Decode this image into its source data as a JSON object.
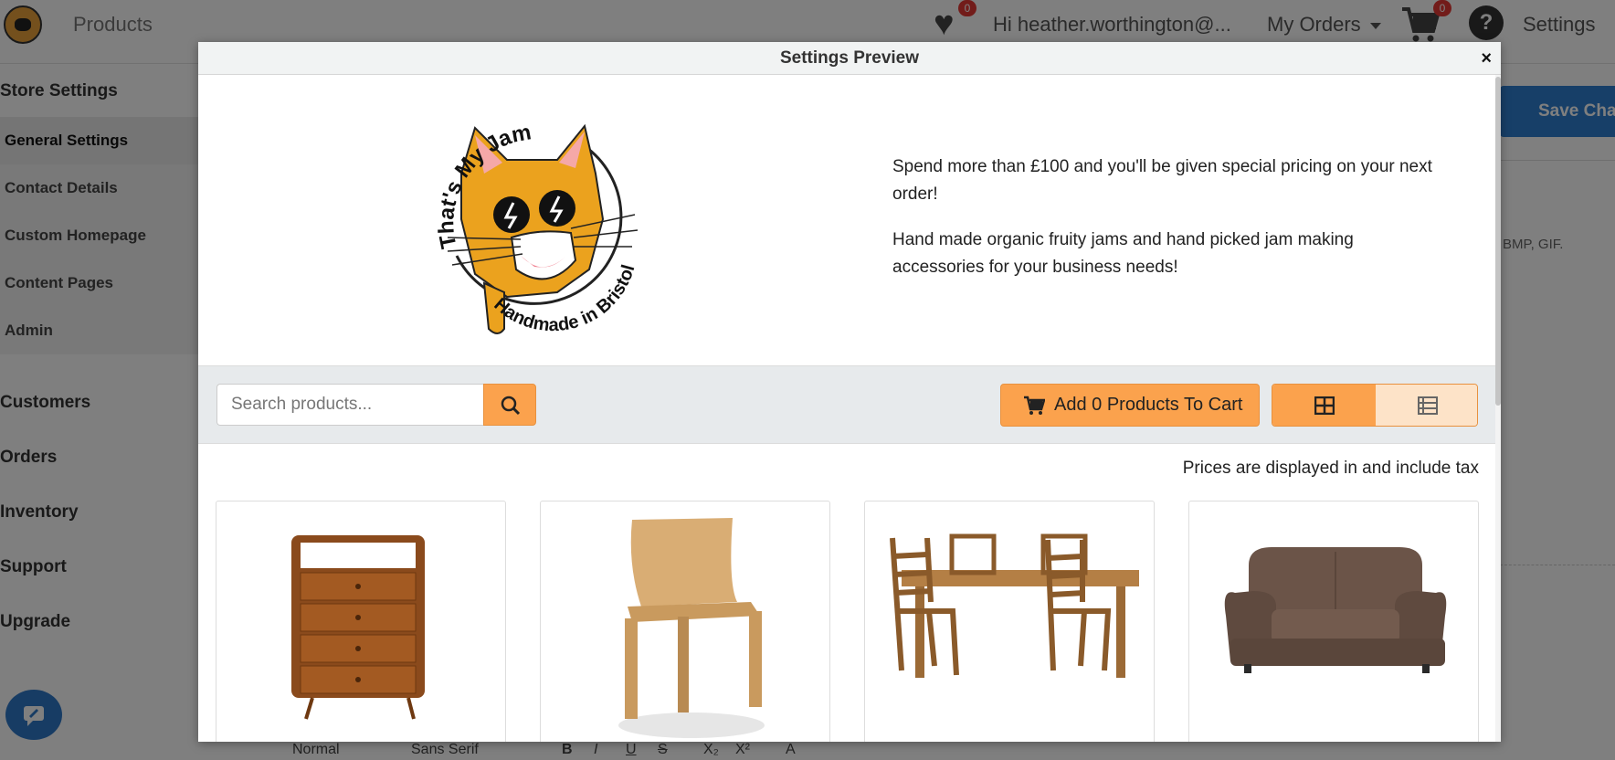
{
  "topbar": {
    "nav_products": "Products",
    "wishlist_count": "0",
    "greeting": "Hi heather.worthington@...",
    "my_orders": "My Orders",
    "cart_count": "0",
    "help": "?",
    "settings": "Settings"
  },
  "sidebar": {
    "store_settings": "Store Settings",
    "items": [
      {
        "label": "General Settings"
      },
      {
        "label": "Contact Details"
      },
      {
        "label": "Custom Homepage"
      },
      {
        "label": "Content Pages"
      },
      {
        "label": "Admin"
      }
    ],
    "sections": [
      {
        "label": "Customers"
      },
      {
        "label": "Orders"
      },
      {
        "label": "Inventory"
      },
      {
        "label": "Support"
      },
      {
        "label": "Upgrade"
      }
    ]
  },
  "background": {
    "save_label": "Save Cha",
    "file_types_note": "BMP, GIF.",
    "editor": {
      "format": "Normal",
      "font": "Sans Serif",
      "bold": "B",
      "italic": "I",
      "underline": "U",
      "strike": "S",
      "subscript": "X₂",
      "superscript": "X²",
      "color": "A"
    }
  },
  "modal": {
    "title": "Settings Preview",
    "close": "×",
    "logo_text_top": "That's My Jam",
    "logo_text_bottom": "Handmade in Bristol",
    "promo_line_1": "Spend more than £100 and you'll be given special pricing on your next order!",
    "promo_line_2": "Hand made organic fruity jams and hand picked jam making accessories for your business needs!",
    "search_placeholder": "Search products...",
    "add_to_cart": "Add 0 Products To Cart",
    "tax_note": "Prices are displayed in and include tax",
    "products": [
      {
        "image": "wooden-chest-of-drawers"
      },
      {
        "image": "wooden-chair"
      },
      {
        "image": "dining-table-with-chairs"
      },
      {
        "image": "brown-sofa"
      }
    ]
  },
  "colors": {
    "accent": "#fba24d",
    "primary_blue": "#2f7fd0",
    "badge_red": "#e53935"
  }
}
